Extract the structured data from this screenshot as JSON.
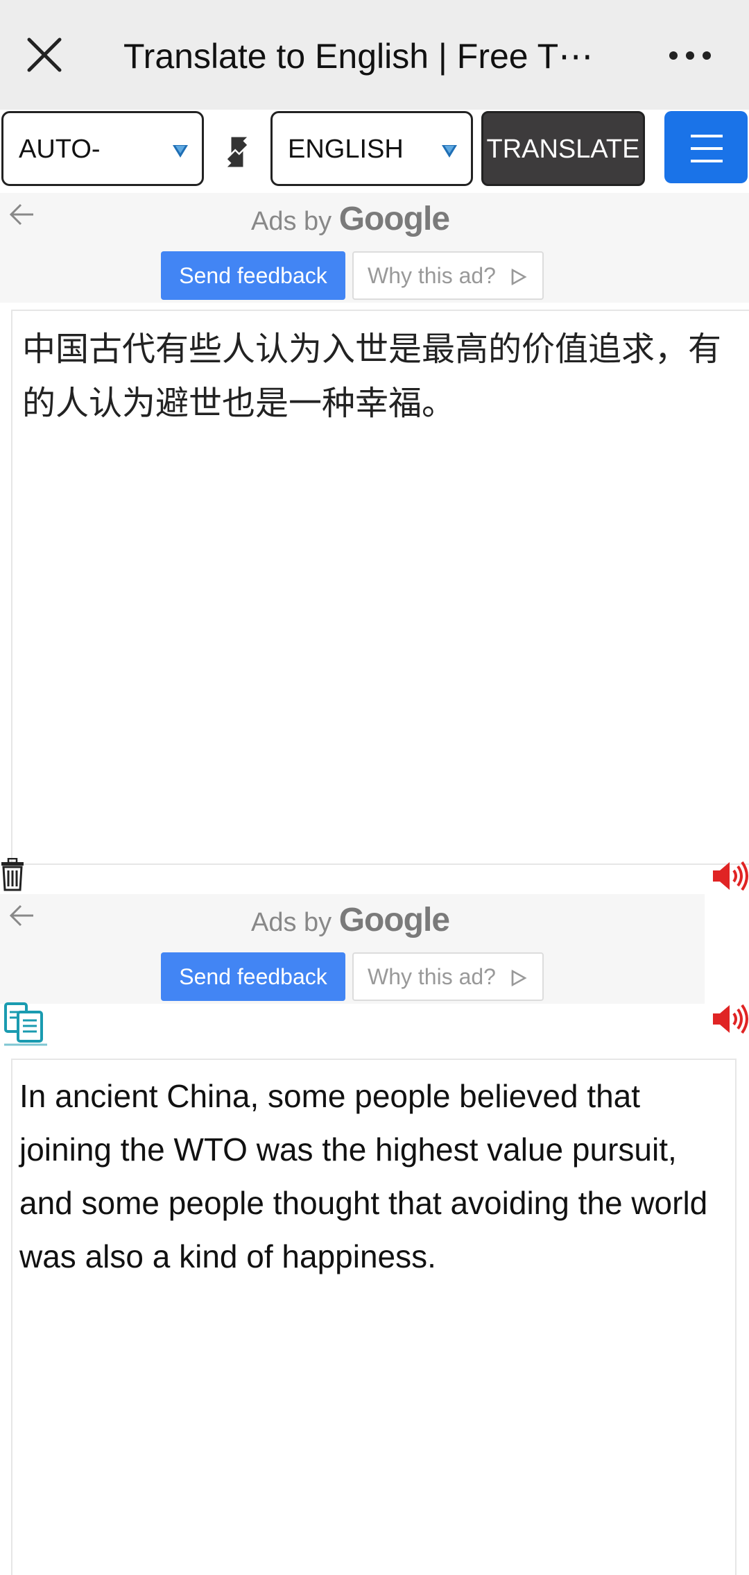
{
  "header": {
    "title": "Translate to English | Free T⋯"
  },
  "toolbar": {
    "source_language": "AUTO-",
    "target_language": "ENGLISH",
    "translate_label": "TRANSLATE"
  },
  "ads": {
    "ads_by": "Ads by",
    "google": "Google",
    "feedback_label": "Send feedback",
    "why_label": "Why this ad?"
  },
  "source": {
    "text": "中国古代有些人认为入世是最高的价值追求，有的人认为避世也是一种幸福。"
  },
  "result": {
    "text": "In ancient China, some people believed that joining the WTO was the highest value pursuit, and some people thought that avoiding the world was also a kind of happiness."
  },
  "icons": {
    "close": "close-icon",
    "more": "more-icon",
    "swap": "swap-icon",
    "menu": "hamburger-icon",
    "back": "back-arrow-icon",
    "trash": "trash-icon",
    "speaker": "speaker-icon",
    "copy": "copy-icon"
  },
  "colors": {
    "menu_button": "#1a73e8",
    "feedback_button": "#4285f4",
    "translate_button": "#3d3b3c",
    "speaker": "#e02424",
    "copy_icon": "#1a9bb0"
  }
}
